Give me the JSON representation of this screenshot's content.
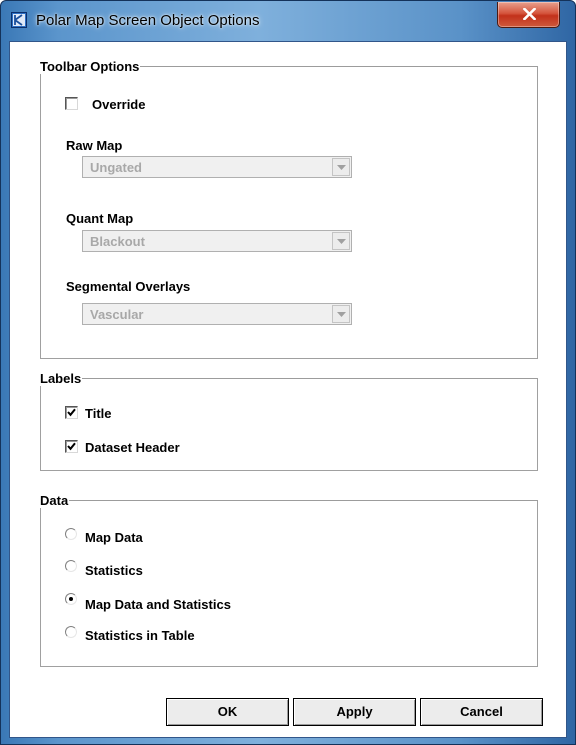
{
  "window": {
    "title": "Polar Map Screen Object Options",
    "app_icon": "app-icon",
    "close_icon": "close-icon"
  },
  "toolbar_options": {
    "legend": "Toolbar Options",
    "override": {
      "label": "Override",
      "checked": false
    },
    "raw_map": {
      "label": "Raw Map",
      "value": "Ungated",
      "enabled": false
    },
    "quant_map": {
      "label": "Quant Map",
      "value": "Blackout",
      "enabled": false
    },
    "segmental_overlays": {
      "label": "Segmental Overlays",
      "value": "Vascular",
      "enabled": false
    }
  },
  "labels": {
    "legend": "Labels",
    "title": {
      "label": "Title",
      "checked": true
    },
    "dataset_header": {
      "label": "Dataset Header",
      "checked": true
    }
  },
  "data": {
    "legend": "Data",
    "options": [
      {
        "label": "Map Data",
        "selected": false
      },
      {
        "label": "Statistics",
        "selected": false
      },
      {
        "label": "Map Data and Statistics",
        "selected": true
      },
      {
        "label": "Statistics in Table",
        "selected": false
      }
    ]
  },
  "buttons": {
    "ok": "OK",
    "apply": "Apply",
    "cancel": "Cancel"
  },
  "colors": {
    "titlebar": "#6fa3d6",
    "close_button": "#c83a22",
    "disabled_text": "#a8a8a8"
  }
}
